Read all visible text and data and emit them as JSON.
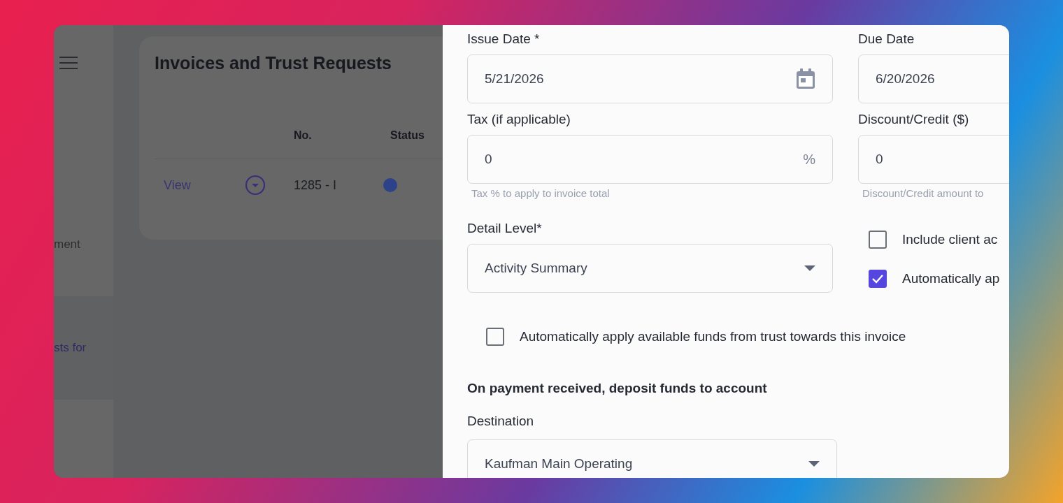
{
  "sidebar": {
    "items": [
      {
        "label": "ment",
        "selected": false
      },
      {
        "label": "sts for",
        "selected": true
      }
    ]
  },
  "page": {
    "title": "Invoices and Trust Requests"
  },
  "table": {
    "columns": [
      "No.",
      "Status"
    ],
    "rows": [
      {
        "action": "View",
        "number": "1285 - I"
      }
    ]
  },
  "drawer": {
    "issue_date": {
      "label": "Issue Date *",
      "value": "5/21/2026"
    },
    "due_date": {
      "label": "Due Date",
      "value": "6/20/2026"
    },
    "tax": {
      "label": "Tax (if applicable)",
      "value": "0",
      "suffix": "%",
      "helper": "Tax % to apply to invoice total"
    },
    "discount": {
      "label": "Discount/Credit ($)",
      "value": "0",
      "helper": "Discount/Credit amount to"
    },
    "detail_level": {
      "label": "Detail Level*",
      "value": "Activity Summary"
    },
    "side_options": [
      {
        "label": "Include client ac",
        "checked": false
      },
      {
        "label": "Automatically ap",
        "checked": true
      }
    ],
    "trust_option": {
      "label": "Automatically apply available funds from trust towards this invoice",
      "checked": false
    },
    "deposit_heading": "On payment received, deposit funds to account",
    "destination": {
      "label": "Destination",
      "value": "Kaufman Main Operating"
    }
  }
}
